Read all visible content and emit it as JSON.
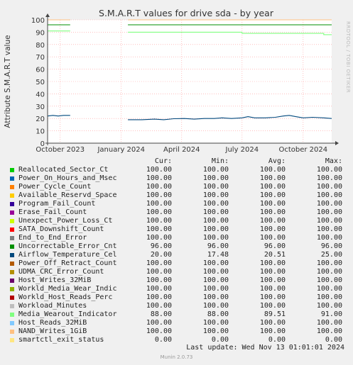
{
  "chart_data": {
    "type": "line",
    "title": "S.M.A.R.T values for drive sda - by year",
    "ylabel": "Attribute S.M.A.R.T value",
    "ylim": [
      0,
      100
    ],
    "yticks": [
      0,
      10,
      20,
      30,
      40,
      50,
      60,
      70,
      80,
      90,
      100
    ],
    "xlim": [
      "2023-09-12",
      "2024-11-13"
    ],
    "xticks": [
      {
        "date": "2023-10-01",
        "label": "October 2023"
      },
      {
        "date": "2024-01-01",
        "label": "January 2024"
      },
      {
        "date": "2024-04-01",
        "label": "April 2024"
      },
      {
        "date": "2024-07-01",
        "label": "July 2024"
      },
      {
        "date": "2024-10-01",
        "label": "October 2024"
      }
    ],
    "gap": [
      "2023-10-16",
      "2024-01-11"
    ],
    "series": [
      {
        "name": "Reallocated_Sector_Ct",
        "color": "#00cc00",
        "points": [
          [
            "2023-09-12",
            100
          ],
          [
            "2023-10-16",
            100
          ],
          [
            "2024-01-11",
            100
          ],
          [
            "2024-11-13",
            100
          ]
        ]
      },
      {
        "name": "Power_On_Hours_and_Msec",
        "color": "#0066b3",
        "points": [
          [
            "2023-09-12",
            100
          ],
          [
            "2023-10-16",
            100
          ],
          [
            "2024-01-11",
            100
          ],
          [
            "2024-11-13",
            100
          ]
        ]
      },
      {
        "name": "Power_Cycle_Count",
        "color": "#ff8000",
        "points": [
          [
            "2023-09-12",
            100
          ],
          [
            "2023-10-16",
            100
          ],
          [
            "2024-01-11",
            100
          ],
          [
            "2024-11-13",
            100
          ]
        ]
      },
      {
        "name": "Available_Reservd_Space",
        "color": "#ffcc00",
        "points": [
          [
            "2023-09-12",
            100
          ],
          [
            "2023-10-16",
            100
          ],
          [
            "2024-01-11",
            100
          ],
          [
            "2024-11-13",
            100
          ]
        ]
      },
      {
        "name": "Program_Fail_Count",
        "color": "#330099",
        "points": [
          [
            "2023-09-12",
            100
          ],
          [
            "2023-10-16",
            100
          ],
          [
            "2024-01-11",
            100
          ],
          [
            "2024-11-13",
            100
          ]
        ]
      },
      {
        "name": "Erase_Fail_Count",
        "color": "#990099",
        "points": [
          [
            "2023-09-12",
            100
          ],
          [
            "2023-10-16",
            100
          ],
          [
            "2024-01-11",
            100
          ],
          [
            "2024-11-13",
            100
          ]
        ]
      },
      {
        "name": "Unexpect_Power_Loss_Ct",
        "color": "#ccff00",
        "points": [
          [
            "2023-09-12",
            100
          ],
          [
            "2023-10-16",
            100
          ],
          [
            "2024-01-11",
            100
          ],
          [
            "2024-11-13",
            100
          ]
        ]
      },
      {
        "name": "SATA_Downshift_Count",
        "color": "#ff0000",
        "points": [
          [
            "2023-09-12",
            100
          ],
          [
            "2023-10-16",
            100
          ],
          [
            "2024-01-11",
            100
          ],
          [
            "2024-11-13",
            100
          ]
        ]
      },
      {
        "name": "End_to_End_Error",
        "color": "#808080",
        "points": [
          [
            "2023-09-12",
            100
          ],
          [
            "2023-10-16",
            100
          ],
          [
            "2024-01-11",
            100
          ],
          [
            "2024-11-13",
            100
          ]
        ]
      },
      {
        "name": "Uncorrectable_Error_Cnt",
        "color": "#008f00",
        "points": [
          [
            "2023-09-12",
            96
          ],
          [
            "2023-10-16",
            96
          ],
          [
            "2024-01-11",
            96
          ],
          [
            "2024-11-13",
            96
          ]
        ]
      },
      {
        "name": "Airflow_Temperature_Cel",
        "color": "#00487d",
        "points": [
          [
            "2023-09-12",
            22
          ],
          [
            "2023-09-20",
            22.5
          ],
          [
            "2023-09-28",
            22
          ],
          [
            "2023-10-06",
            22.5
          ],
          [
            "2023-10-16",
            22.5
          ],
          [
            "2024-01-11",
            19
          ],
          [
            "2024-02-01",
            19
          ],
          [
            "2024-02-20",
            19.5
          ],
          [
            "2024-03-05",
            19
          ],
          [
            "2024-03-20",
            19.8
          ],
          [
            "2024-04-05",
            20
          ],
          [
            "2024-04-20",
            19.5
          ],
          [
            "2024-05-05",
            20
          ],
          [
            "2024-05-20",
            20
          ],
          [
            "2024-06-01",
            20.5
          ],
          [
            "2024-06-15",
            20
          ],
          [
            "2024-07-01",
            20.5
          ],
          [
            "2024-07-10",
            21.5
          ],
          [
            "2024-07-20",
            20.5
          ],
          [
            "2024-08-05",
            20.5
          ],
          [
            "2024-08-20",
            21
          ],
          [
            "2024-09-01",
            22
          ],
          [
            "2024-09-10",
            22.5
          ],
          [
            "2024-09-20",
            21.5
          ],
          [
            "2024-10-01",
            20.5
          ],
          [
            "2024-10-15",
            21
          ],
          [
            "2024-11-01",
            20.5
          ],
          [
            "2024-11-13",
            20
          ]
        ]
      },
      {
        "name": "Power_Off_Retract_Count",
        "color": "#b35a00",
        "points": [
          [
            "2023-09-12",
            100
          ],
          [
            "2023-10-16",
            100
          ],
          [
            "2024-01-11",
            100
          ],
          [
            "2024-11-13",
            100
          ]
        ]
      },
      {
        "name": "UDMA_CRC_Error_Count",
        "color": "#b38f00",
        "points": [
          [
            "2023-09-12",
            100
          ],
          [
            "2023-10-16",
            100
          ],
          [
            "2024-01-11",
            100
          ],
          [
            "2024-11-13",
            100
          ]
        ]
      },
      {
        "name": "Host_Writes_32MiB",
        "color": "#6b006b",
        "points": [
          [
            "2023-09-12",
            100
          ],
          [
            "2023-10-16",
            100
          ],
          [
            "2024-01-11",
            100
          ],
          [
            "2024-11-13",
            100
          ]
        ]
      },
      {
        "name": "Workld_Media_Wear_Indic",
        "color": "#8fb300",
        "points": [
          [
            "2023-09-12",
            100
          ],
          [
            "2023-10-16",
            100
          ],
          [
            "2024-01-11",
            100
          ],
          [
            "2024-11-13",
            100
          ]
        ]
      },
      {
        "name": "Workld_Host_Reads_Perc",
        "color": "#b30000",
        "points": [
          [
            "2023-09-12",
            100
          ],
          [
            "2023-10-16",
            100
          ],
          [
            "2024-01-11",
            100
          ],
          [
            "2024-11-13",
            100
          ]
        ]
      },
      {
        "name": "Workload_Minutes",
        "color": "#bebebe",
        "points": [
          [
            "2023-09-12",
            100
          ],
          [
            "2023-10-16",
            100
          ],
          [
            "2024-01-11",
            100
          ],
          [
            "2024-11-13",
            100
          ]
        ]
      },
      {
        "name": "Media_Wearout_Indicator",
        "color": "#80ff80",
        "points": [
          [
            "2023-09-12",
            91
          ],
          [
            "2023-10-16",
            91
          ],
          [
            "2024-01-11",
            90
          ],
          [
            "2024-06-20",
            90
          ],
          [
            "2024-07-01",
            89
          ],
          [
            "2024-10-25",
            89
          ],
          [
            "2024-11-01",
            88
          ],
          [
            "2024-11-13",
            88
          ]
        ]
      },
      {
        "name": "Host_Reads_32MiB",
        "color": "#80c9ff",
        "points": [
          [
            "2023-09-12",
            100
          ],
          [
            "2023-10-16",
            100
          ],
          [
            "2024-01-11",
            100
          ],
          [
            "2024-11-13",
            100
          ]
        ]
      },
      {
        "name": "NAND_Writes_1GiB",
        "color": "#ffc080",
        "points": [
          [
            "2023-09-12",
            100
          ],
          [
            "2023-10-16",
            100
          ],
          [
            "2024-01-11",
            100
          ],
          [
            "2024-11-13",
            100
          ]
        ]
      },
      {
        "name": "smartctl_exit_status",
        "color": "#ffe680",
        "points": [
          [
            "2023-09-12",
            0
          ],
          [
            "2023-10-16",
            0
          ],
          [
            "2024-01-11",
            0
          ],
          [
            "2024-11-13",
            0
          ]
        ]
      }
    ]
  },
  "legend": {
    "headers": {
      "cur": "Cur:",
      "min": "Min:",
      "avg": "Avg:",
      "max": "Max:"
    },
    "rows": [
      {
        "name": "Reallocated_Sector_Ct",
        "color": "#00cc00",
        "cur": "100.00",
        "min": "100.00",
        "avg": "100.00",
        "max": "100.00"
      },
      {
        "name": "Power_On_Hours_and_Msec",
        "color": "#0066b3",
        "cur": "100.00",
        "min": "100.00",
        "avg": "100.00",
        "max": "100.00"
      },
      {
        "name": "Power_Cycle_Count",
        "color": "#ff8000",
        "cur": "100.00",
        "min": "100.00",
        "avg": "100.00",
        "max": "100.00"
      },
      {
        "name": "Available_Reservd_Space",
        "color": "#ffcc00",
        "cur": "100.00",
        "min": "100.00",
        "avg": "100.00",
        "max": "100.00"
      },
      {
        "name": "Program_Fail_Count",
        "color": "#330099",
        "cur": "100.00",
        "min": "100.00",
        "avg": "100.00",
        "max": "100.00"
      },
      {
        "name": "Erase_Fail_Count",
        "color": "#990099",
        "cur": "100.00",
        "min": "100.00",
        "avg": "100.00",
        "max": "100.00"
      },
      {
        "name": "Unexpect_Power_Loss_Ct",
        "color": "#ccff00",
        "cur": "100.00",
        "min": "100.00",
        "avg": "100.00",
        "max": "100.00"
      },
      {
        "name": "SATA_Downshift_Count",
        "color": "#ff0000",
        "cur": "100.00",
        "min": "100.00",
        "avg": "100.00",
        "max": "100.00"
      },
      {
        "name": "End_to_End_Error",
        "color": "#808080",
        "cur": "100.00",
        "min": "100.00",
        "avg": "100.00",
        "max": "100.00"
      },
      {
        "name": "Uncorrectable_Error_Cnt",
        "color": "#008f00",
        "cur": "96.00",
        "min": "96.00",
        "avg": "96.00",
        "max": "96.00"
      },
      {
        "name": "Airflow_Temperature_Cel",
        "color": "#00487d",
        "cur": "20.00",
        "min": "17.48",
        "avg": "20.51",
        "max": "25.00"
      },
      {
        "name": "Power_Off_Retract_Count",
        "color": "#b35a00",
        "cur": "100.00",
        "min": "100.00",
        "avg": "100.00",
        "max": "100.00"
      },
      {
        "name": "UDMA_CRC_Error_Count",
        "color": "#b38f00",
        "cur": "100.00",
        "min": "100.00",
        "avg": "100.00",
        "max": "100.00"
      },
      {
        "name": "Host_Writes_32MiB",
        "color": "#6b006b",
        "cur": "100.00",
        "min": "100.00",
        "avg": "100.00",
        "max": "100.00"
      },
      {
        "name": "Workld_Media_Wear_Indic",
        "color": "#8fb300",
        "cur": "100.00",
        "min": "100.00",
        "avg": "100.00",
        "max": "100.00"
      },
      {
        "name": "Workld_Host_Reads_Perc",
        "color": "#b30000",
        "cur": "100.00",
        "min": "100.00",
        "avg": "100.00",
        "max": "100.00"
      },
      {
        "name": "Workload_Minutes",
        "color": "#bebebe",
        "cur": "100.00",
        "min": "100.00",
        "avg": "100.00",
        "max": "100.00"
      },
      {
        "name": "Media_Wearout_Indicator",
        "color": "#80ff80",
        "cur": "88.00",
        "min": "88.00",
        "avg": "89.51",
        "max": "91.00"
      },
      {
        "name": "Host_Reads_32MiB",
        "color": "#80c9ff",
        "cur": "100.00",
        "min": "100.00",
        "avg": "100.00",
        "max": "100.00"
      },
      {
        "name": "NAND_Writes_1GiB",
        "color": "#ffc080",
        "cur": "100.00",
        "min": "100.00",
        "avg": "100.00",
        "max": "100.00"
      },
      {
        "name": "smartctl_exit_status",
        "color": "#ffe680",
        "cur": "0.00",
        "min": "0.00",
        "avg": "0.00",
        "max": "0.00"
      }
    ]
  },
  "last_update": "Last update: Wed Nov 13 01:01:01 2024",
  "footer": "Munin 2.0.73",
  "watermark": "RRDTOOL / TOBI OETIKER"
}
